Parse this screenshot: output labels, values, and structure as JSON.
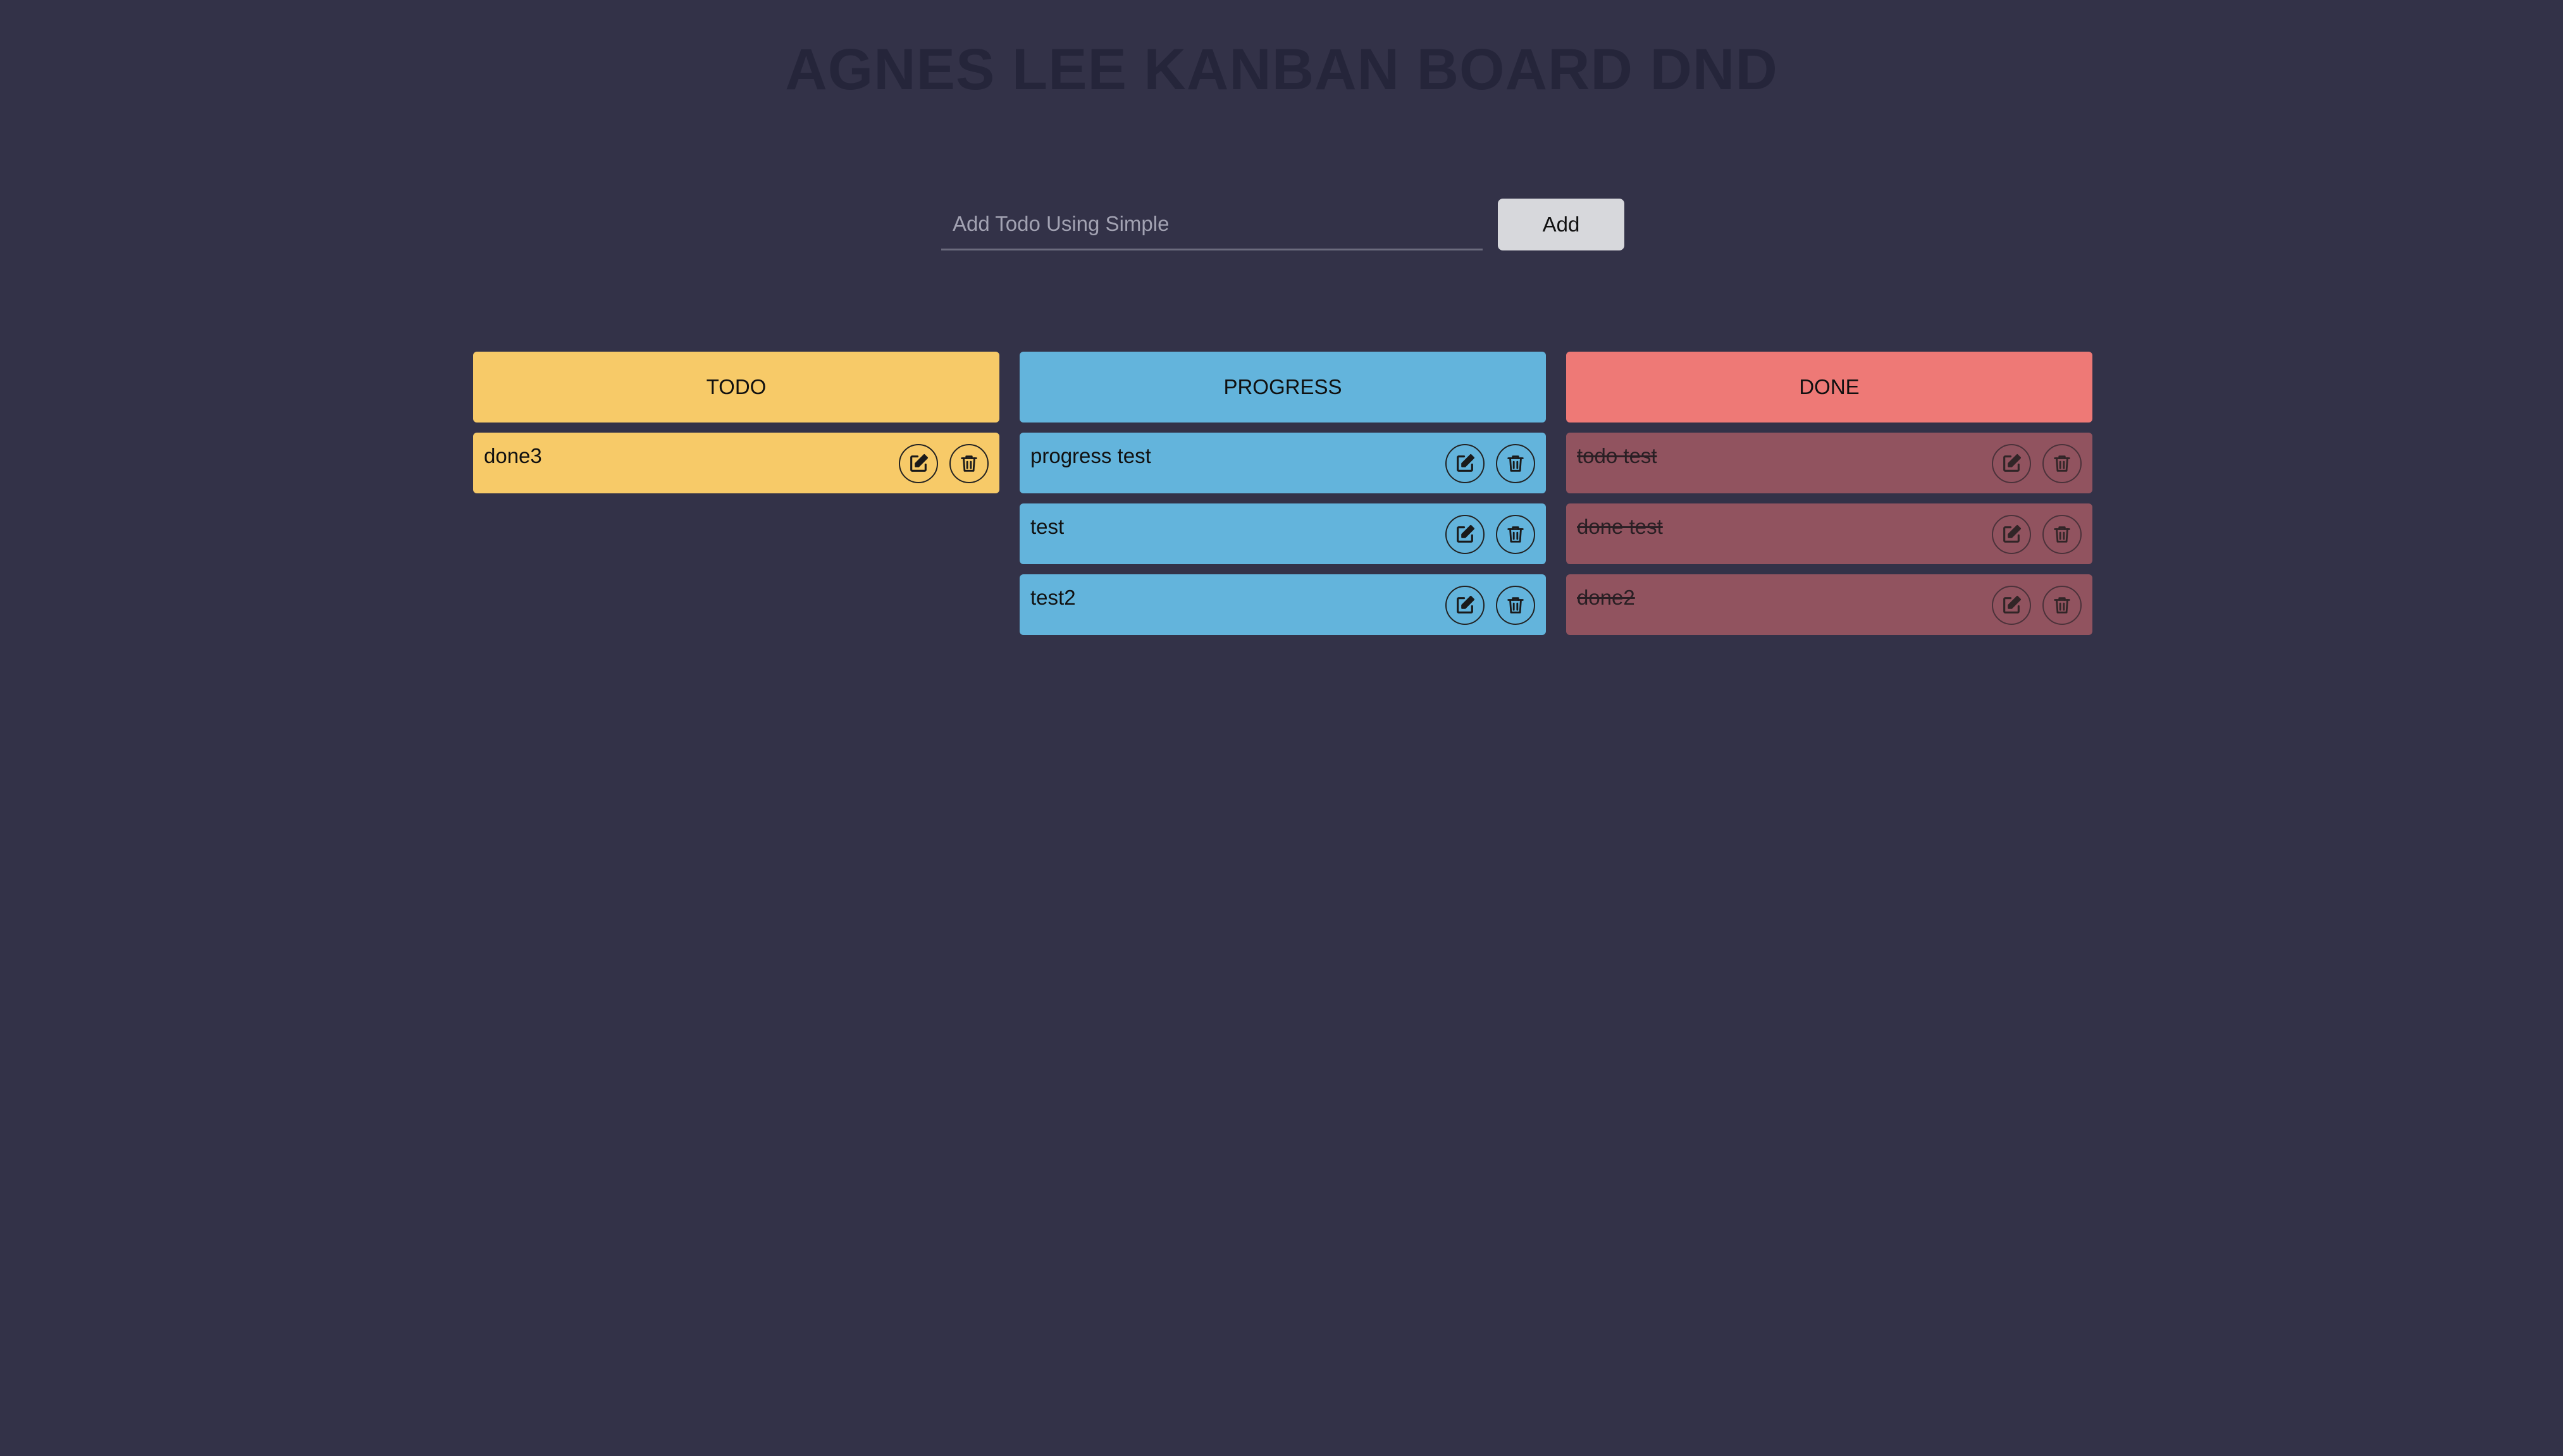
{
  "app": {
    "title": "AGNES LEE KANBAN BOARD DND"
  },
  "form": {
    "placeholder": "Add Todo Using Simple",
    "value": "",
    "add_label": "Add"
  },
  "columns": [
    {
      "key": "todo",
      "title": "TODO",
      "header_color": "#f7ca68",
      "card_color": "#f7ca68",
      "done": false,
      "cards": [
        {
          "text": "done3"
        }
      ]
    },
    {
      "key": "progress",
      "title": "PROGRESS",
      "header_color": "#63b4dc",
      "card_color": "#63b4dc",
      "done": false,
      "cards": [
        {
          "text": "progress test"
        },
        {
          "text": "test"
        },
        {
          "text": "test2"
        }
      ]
    },
    {
      "key": "done",
      "title": "DONE",
      "header_color": "#ee7976",
      "card_color": "#91535f",
      "done": true,
      "cards": [
        {
          "text": "todo test"
        },
        {
          "text": "done test"
        },
        {
          "text": "done2"
        }
      ]
    }
  ],
  "icons": {
    "edit": "edit-icon",
    "delete": "trash-icon"
  }
}
